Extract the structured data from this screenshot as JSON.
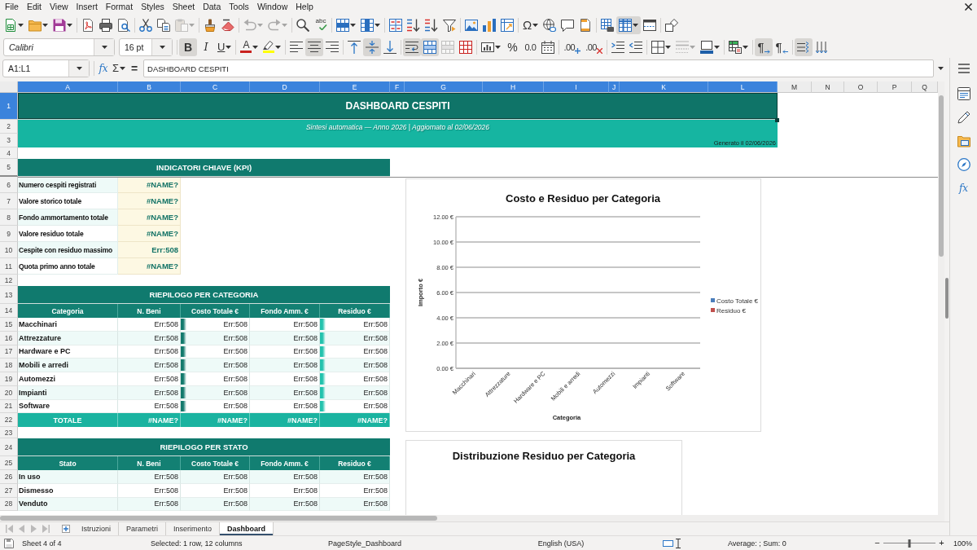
{
  "menu_bar": [
    "File",
    "Edit",
    "View",
    "Insert",
    "Format",
    "Styles",
    "Sheet",
    "Data",
    "Tools",
    "Window",
    "Help"
  ],
  "standard_toolbar": [
    [
      {
        "kind": "new",
        "on": false,
        "disabled": false
      },
      {
        "kind": "open",
        "on": false,
        "disabled": false
      },
      {
        "kind": "save",
        "on": false,
        "disabled": false
      }
    ],
    [
      {
        "kind": "export_pdf",
        "on": false,
        "disabled": false
      },
      {
        "kind": "print",
        "on": false,
        "disabled": false
      },
      {
        "kind": "print_preview",
        "on": false,
        "disabled": false
      }
    ],
    [
      {
        "kind": "cut",
        "on": false,
        "disabled": false
      },
      {
        "kind": "copy",
        "on": false,
        "disabled": false
      },
      {
        "kind": "paste",
        "on": false,
        "disabled": true
      }
    ],
    [
      {
        "kind": "clone_formatting",
        "on": false,
        "disabled": false
      },
      {
        "kind": "clear_formatting",
        "on": false,
        "disabled": false
      }
    ],
    [
      {
        "kind": "undo",
        "on": false,
        "disabled": true
      },
      {
        "kind": "redo",
        "on": false,
        "disabled": true
      }
    ],
    [
      {
        "kind": "find_replace",
        "on": false,
        "disabled": false
      },
      {
        "kind": "spelling",
        "glyph": "abc",
        "on": false,
        "disabled": false
      }
    ],
    [
      {
        "kind": "rows",
        "on": false,
        "disabled": false
      },
      {
        "kind": "columns",
        "on": false,
        "disabled": false
      }
    ],
    [
      {
        "kind": "sort",
        "on": false,
        "disabled": false
      },
      {
        "kind": "sort_ascending",
        "on": false,
        "disabled": false
      },
      {
        "kind": "sort_descending",
        "on": false,
        "disabled": false
      },
      {
        "kind": "autofilter",
        "on": false,
        "disabled": false
      }
    ],
    [
      {
        "kind": "image",
        "on": false,
        "disabled": false
      },
      {
        "kind": "chart",
        "on": false,
        "disabled": false
      },
      {
        "kind": "pivot_table",
        "on": false,
        "disabled": false
      }
    ],
    [
      {
        "kind": "special_character",
        "glyph": "Ω",
        "on": false,
        "disabled": false
      },
      {
        "kind": "hyperlink",
        "on": false,
        "disabled": false
      },
      {
        "kind": "comment",
        "on": false,
        "disabled": false
      },
      {
        "kind": "header_footer",
        "on": false,
        "disabled": false
      }
    ],
    [
      {
        "kind": "print_area",
        "on": false,
        "disabled": false
      },
      {
        "kind": "freeze",
        "on": true,
        "disabled": false
      },
      {
        "kind": "split_window",
        "on": false,
        "disabled": false
      }
    ],
    [
      {
        "kind": "shapes",
        "on": false,
        "disabled": false
      }
    ]
  ],
  "formatting_toolbar": {
    "font_name": "Calibri",
    "font_size": "16 pt",
    "groups": [
      [
        {
          "kind": "bold",
          "glyph": "B",
          "on": true,
          "disabled": false
        },
        {
          "kind": "italic",
          "glyph": "I",
          "on": false,
          "disabled": false
        },
        {
          "kind": "underline",
          "glyph": "U",
          "on": false,
          "disabled": false
        }
      ],
      [
        {
          "kind": "font_color",
          "glyph": "A",
          "color": "#c9211e",
          "on": false,
          "disabled": false
        },
        {
          "kind": "highlight",
          "color": "#ffff00",
          "on": false,
          "disabled": false
        }
      ],
      [
        {
          "kind": "align_left",
          "on": false,
          "disabled": false
        },
        {
          "kind": "align_center",
          "on": true,
          "disabled": false
        },
        {
          "kind": "align_right",
          "on": false,
          "disabled": false
        }
      ],
      [
        {
          "kind": "align_top",
          "on": false,
          "disabled": false
        },
        {
          "kind": "align_middle",
          "on": true,
          "disabled": false
        },
        {
          "kind": "align_bottom",
          "on": false,
          "disabled": false
        }
      ],
      [
        {
          "kind": "wrap_text",
          "on": true,
          "disabled": false
        },
        {
          "kind": "merge_center",
          "on": true,
          "disabled": false
        },
        {
          "kind": "merge",
          "on": false,
          "disabled": true
        },
        {
          "kind": "unmerge",
          "on": false,
          "disabled": false
        }
      ],
      [
        {
          "kind": "number_format",
          "on": false,
          "disabled": false
        },
        {
          "kind": "percent",
          "glyph": "%",
          "on": false,
          "disabled": false
        },
        {
          "kind": "number",
          "glyph": "0.0",
          "on": false,
          "disabled": false
        },
        {
          "kind": "date",
          "on": false,
          "disabled": false
        }
      ],
      [
        {
          "kind": "add_decimal",
          "glyph": ".00",
          "on": false,
          "disabled": false
        },
        {
          "kind": "delete_decimal",
          "glyph": ".00",
          "on": false,
          "disabled": false
        }
      ],
      [
        {
          "kind": "indent_increase",
          "on": false,
          "disabled": false
        },
        {
          "kind": "indent_decrease",
          "on": false,
          "disabled": false
        }
      ],
      [
        {
          "kind": "borders",
          "on": false,
          "disabled": false
        },
        {
          "kind": "border_style",
          "on": false,
          "disabled": true
        },
        {
          "kind": "border_color",
          "on": false,
          "disabled": false
        }
      ],
      [
        {
          "kind": "conditional",
          "on": false,
          "disabled": false
        }
      ],
      [
        {
          "kind": "ltr",
          "glyph": "¶",
          "on": true,
          "disabled": false
        },
        {
          "kind": "rtl",
          "glyph": "¶",
          "on": false,
          "disabled": false
        }
      ],
      [
        {
          "kind": "text_direction",
          "on": true,
          "disabled": false
        },
        {
          "kind": "vertical_text",
          "on": false,
          "disabled": false
        }
      ]
    ]
  },
  "formula_bar": {
    "name_box": "A1:L1",
    "function_wizard": "fx",
    "sum": "Σ",
    "formula": "=",
    "content": "DASHBOARD CESPITI"
  },
  "sheet": {
    "columns": [
      {
        "label": "A",
        "selected": true
      },
      {
        "label": "B",
        "selected": true
      },
      {
        "label": "C",
        "selected": true
      },
      {
        "label": "D",
        "selected": true
      },
      {
        "label": "E",
        "selected": true
      },
      {
        "label": "F",
        "selected": true
      },
      {
        "label": "G",
        "selected": true
      },
      {
        "label": "H",
        "selected": true
      },
      {
        "label": "I",
        "selected": true
      },
      {
        "label": "J",
        "selected": true
      },
      {
        "label": "K",
        "selected": true
      },
      {
        "label": "L",
        "selected": true
      },
      {
        "label": "M",
        "selected": false
      },
      {
        "label": "N",
        "selected": false
      },
      {
        "label": "O",
        "selected": false
      },
      {
        "label": "P",
        "selected": false
      },
      {
        "label": "Q",
        "selected": false
      }
    ],
    "row_headers": [
      {
        "label": "1",
        "selected": true,
        "frozen": false
      },
      {
        "label": "2",
        "selected": false,
        "frozen": false
      },
      {
        "label": "3",
        "selected": false,
        "frozen": false
      },
      {
        "label": "4",
        "selected": false,
        "frozen": false
      },
      {
        "label": "5",
        "selected": false,
        "frozen": true
      },
      {
        "label": "6",
        "selected": false,
        "frozen": false
      },
      {
        "label": "7",
        "selected": false,
        "frozen": false
      },
      {
        "label": "8",
        "selected": false,
        "frozen": false
      },
      {
        "label": "9",
        "selected": false,
        "frozen": false
      },
      {
        "label": "10",
        "selected": false,
        "frozen": false
      },
      {
        "label": "11",
        "selected": false,
        "frozen": false
      },
      {
        "label": "12",
        "selected": false,
        "frozen": false
      },
      {
        "label": "13",
        "selected": false,
        "frozen": false
      },
      {
        "label": "14",
        "selected": false,
        "frozen": false
      },
      {
        "label": "15",
        "selected": false,
        "frozen": false
      },
      {
        "label": "16",
        "selected": false,
        "frozen": false
      },
      {
        "label": "17",
        "selected": false,
        "frozen": false
      },
      {
        "label": "18",
        "selected": false,
        "frozen": false
      },
      {
        "label": "19",
        "selected": false,
        "frozen": false
      },
      {
        "label": "20",
        "selected": false,
        "frozen": false
      },
      {
        "label": "21",
        "selected": false,
        "frozen": false
      },
      {
        "label": "22",
        "selected": false,
        "frozen": false
      },
      {
        "label": "23",
        "selected": false,
        "frozen": false
      },
      {
        "label": "24",
        "selected": false,
        "frozen": false
      },
      {
        "label": "25",
        "selected": false,
        "frozen": false
      },
      {
        "label": "26",
        "selected": false,
        "frozen": false
      },
      {
        "label": "27",
        "selected": false,
        "frozen": false
      },
      {
        "label": "28",
        "selected": false,
        "frozen": false
      }
    ],
    "title": "DASHBOARD CESPITI",
    "subtitle": "Sintesi automatica — Anno 2026 | Aggiornato al 02/06/2026",
    "generated": "Generato il 02/06/2026",
    "kpi": {
      "title": "INDICATORI CHIAVE (KPI)",
      "rows": [
        {
          "label": "Numero cespiti registrati",
          "value": "#NAME?"
        },
        {
          "label": "Valore storico totale",
          "value": "#NAME?"
        },
        {
          "label": "Fondo ammortamento totale",
          "value": "#NAME?"
        },
        {
          "label": "Valore residuo totale",
          "value": "#NAME?"
        },
        {
          "label": "Cespite con residuo massimo",
          "value": "Err:508"
        },
        {
          "label": "Quota primo anno totale",
          "value": "#NAME?"
        }
      ]
    },
    "by_category": {
      "title": "RIEPILOGO PER CATEGORIA",
      "columns": [
        {
          "label": "Categoria"
        },
        {
          "label": "N. Beni"
        },
        {
          "label": "Costo Totale €",
          "color": "#137a6d",
          "level": 0.08
        },
        {
          "label": "Fondo Amm. €"
        },
        {
          "label": "Residuo €",
          "color": "#22c2ad",
          "level": 0.08
        }
      ],
      "rows": [
        [
          "Macchinari",
          "Err:508",
          "Err:508",
          "Err:508",
          "Err:508"
        ],
        [
          "Attrezzature",
          "Err:508",
          "Err:508",
          "Err:508",
          "Err:508"
        ],
        [
          "Hardware e PC",
          "Err:508",
          "Err:508",
          "Err:508",
          "Err:508"
        ],
        [
          "Mobili e arredi",
          "Err:508",
          "Err:508",
          "Err:508",
          "Err:508"
        ],
        [
          "Automezzi",
          "Err:508",
          "Err:508",
          "Err:508",
          "Err:508"
        ],
        [
          "Impianti",
          "Err:508",
          "Err:508",
          "Err:508",
          "Err:508"
        ],
        [
          "Software",
          "Err:508",
          "Err:508",
          "Err:508",
          "Err:508"
        ]
      ],
      "total": [
        "TOTALE",
        "#NAME?",
        "#NAME?",
        "#NAME?",
        "#NAME?"
      ]
    },
    "by_status": {
      "title": "RIEPILOGO PER STATO",
      "columns": [
        {
          "label": "Stato"
        },
        {
          "label": "N. Beni"
        },
        {
          "label": "Costo Totale €"
        },
        {
          "label": "Fondo Amm. €"
        },
        {
          "label": "Residuo €"
        }
      ],
      "rows": [
        [
          "In uso",
          "Err:508",
          "Err:508",
          "Err:508",
          "Err:508"
        ],
        [
          "Dismesso",
          "Err:508",
          "Err:508",
          "Err:508",
          "Err:508"
        ],
        [
          "Venduto",
          "Err:508",
          "Err:508",
          "Err:508",
          "Err:508"
        ]
      ]
    },
    "charts": [
      {
        "chart_data": {
          "type": "bar",
          "title": "Costo e Residuo per Categoria",
          "xlabel": "Categoria",
          "ylabel": "Importo €",
          "categories": [
            "Macchinari",
            "Attrezzature",
            "Hardware e PC",
            "Mobili e arredi",
            "Automezzi",
            "Impianti",
            "Software"
          ],
          "series": [
            {
              "name": "Costo Totale €",
              "color": "#4a7ebb",
              "values": [
                0,
                0,
                0,
                0,
                0,
                0,
                0
              ]
            },
            {
              "name": "Residuo €",
              "color": "#c0504d",
              "values": [
                0,
                0,
                0,
                0,
                0,
                0,
                0
              ]
            }
          ],
          "ylim": [
            0,
            12
          ],
          "yticks": [
            {
              "value": 0,
              "label": "0.00 €"
            },
            {
              "value": 2,
              "label": "2.00 €"
            },
            {
              "value": 4,
              "label": "4.00 €"
            },
            {
              "value": 6,
              "label": "6.00 €"
            },
            {
              "value": 8,
              "label": "8.00 €"
            },
            {
              "value": 10,
              "label": "10.00 €"
            },
            {
              "value": 12,
              "label": "12.00 €"
            }
          ],
          "grid": true
        }
      },
      {
        "chart_data": {
          "type": "pie",
          "title": "Distribuzione Residuo per Categoria"
        }
      }
    ]
  },
  "sidebar": [
    {
      "kind": "properties",
      "selected": false
    },
    {
      "kind": "styles",
      "selected": false
    },
    {
      "kind": "gallery",
      "selected": false
    },
    {
      "kind": "navigator",
      "selected": false
    },
    {
      "kind": "functions",
      "glyph": "fx",
      "selected": false
    }
  ],
  "sheet_nav": [
    {
      "kind": "first",
      "disabled": true
    },
    {
      "kind": "previous",
      "disabled": true
    },
    {
      "kind": "next",
      "disabled": true
    },
    {
      "kind": "last",
      "disabled": true
    }
  ],
  "sheet_tabs": [
    {
      "label": "Istruzioni",
      "selected": false
    },
    {
      "label": "Parametri",
      "selected": false
    },
    {
      "label": "Inserimento",
      "selected": false
    },
    {
      "label": "Dashboard",
      "selected": true
    }
  ],
  "status_bar": {
    "sheet": "Sheet 4 of 4",
    "selection": "Selected: 1 row, 12 columns",
    "page_style": "PageStyle_Dashboard",
    "language": "English (USA)",
    "summary": "Average: ; Sum: 0",
    "zoom_out": "−",
    "zoom_slider": {
      "level": 0.5
    },
    "zoom_in": "+",
    "zoom": "100%"
  }
}
